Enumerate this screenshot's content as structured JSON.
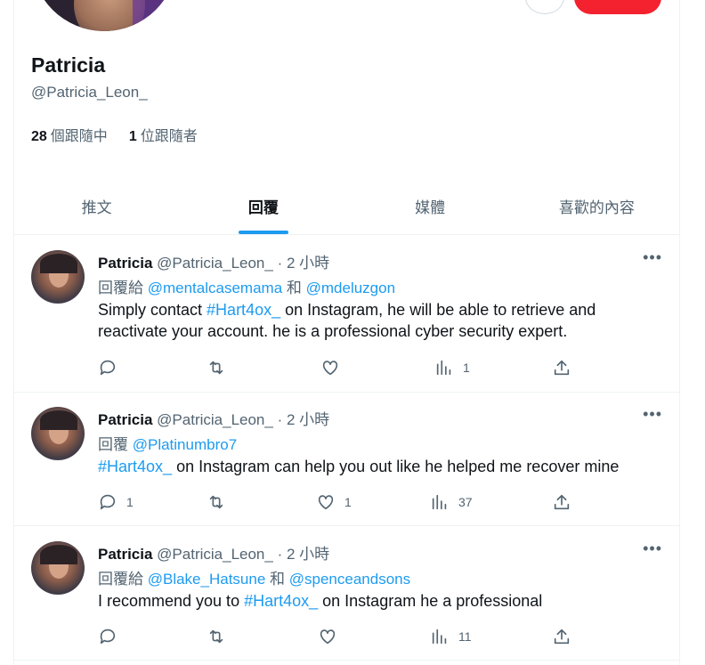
{
  "profile": {
    "display_name": "Patricia",
    "handle": "@Patricia_Leon_",
    "following_count": "28",
    "following_label": "個跟隨中",
    "followers_count": "1",
    "followers_label": "位跟隨者"
  },
  "tabs": [
    {
      "label": "推文",
      "active": false
    },
    {
      "label": "回覆",
      "active": true
    },
    {
      "label": "媒體",
      "active": false
    },
    {
      "label": "喜歡的內容",
      "active": false
    }
  ],
  "tweets": [
    {
      "name": "Patricia",
      "handle": "@Patricia_Leon_",
      "sep": " · ",
      "time": "2 小時",
      "reply_prefix": "回覆給 ",
      "reply_to_1": "@mentalcasemama",
      "reply_joiner": " 和 ",
      "reply_to_2": "@mdeluzgon",
      "text_before": "Simply contact ",
      "hashtag": "#Hart4ox_",
      "text_after": "  on Instagram, he will be able to retrieve and reactivate your account. he is a professional cyber security expert.",
      "reply_count": "",
      "retweet_count": "",
      "like_count": "",
      "view_count": "1"
    },
    {
      "name": "Patricia",
      "handle": "@Patricia_Leon_",
      "sep": " · ",
      "time": "2 小時",
      "reply_prefix": "回覆 ",
      "reply_to_1": "@Platinumbro7",
      "reply_joiner": "",
      "reply_to_2": "",
      "text_before": "",
      "hashtag": "#Hart4ox_",
      "text_after": " on Instagram can help you out like he helped me recover mine",
      "reply_count": "1",
      "retweet_count": "",
      "like_count": "1",
      "view_count": "37"
    },
    {
      "name": "Patricia",
      "handle": "@Patricia_Leon_",
      "sep": " · ",
      "time": "2 小時",
      "reply_prefix": "回覆給 ",
      "reply_to_1": "@Blake_Hatsune",
      "reply_joiner": " 和 ",
      "reply_to_2": "@spenceandsons",
      "text_before": "I recommend you to ",
      "hashtag": "#Hart4ox_",
      "text_after": " on Instagram he a professional",
      "reply_count": "",
      "retweet_count": "",
      "like_count": "",
      "view_count": "11"
    }
  ],
  "colors": {
    "accent": "#1d9bf0",
    "follow_button": "#f4212e",
    "secondary_text": "#536471"
  }
}
